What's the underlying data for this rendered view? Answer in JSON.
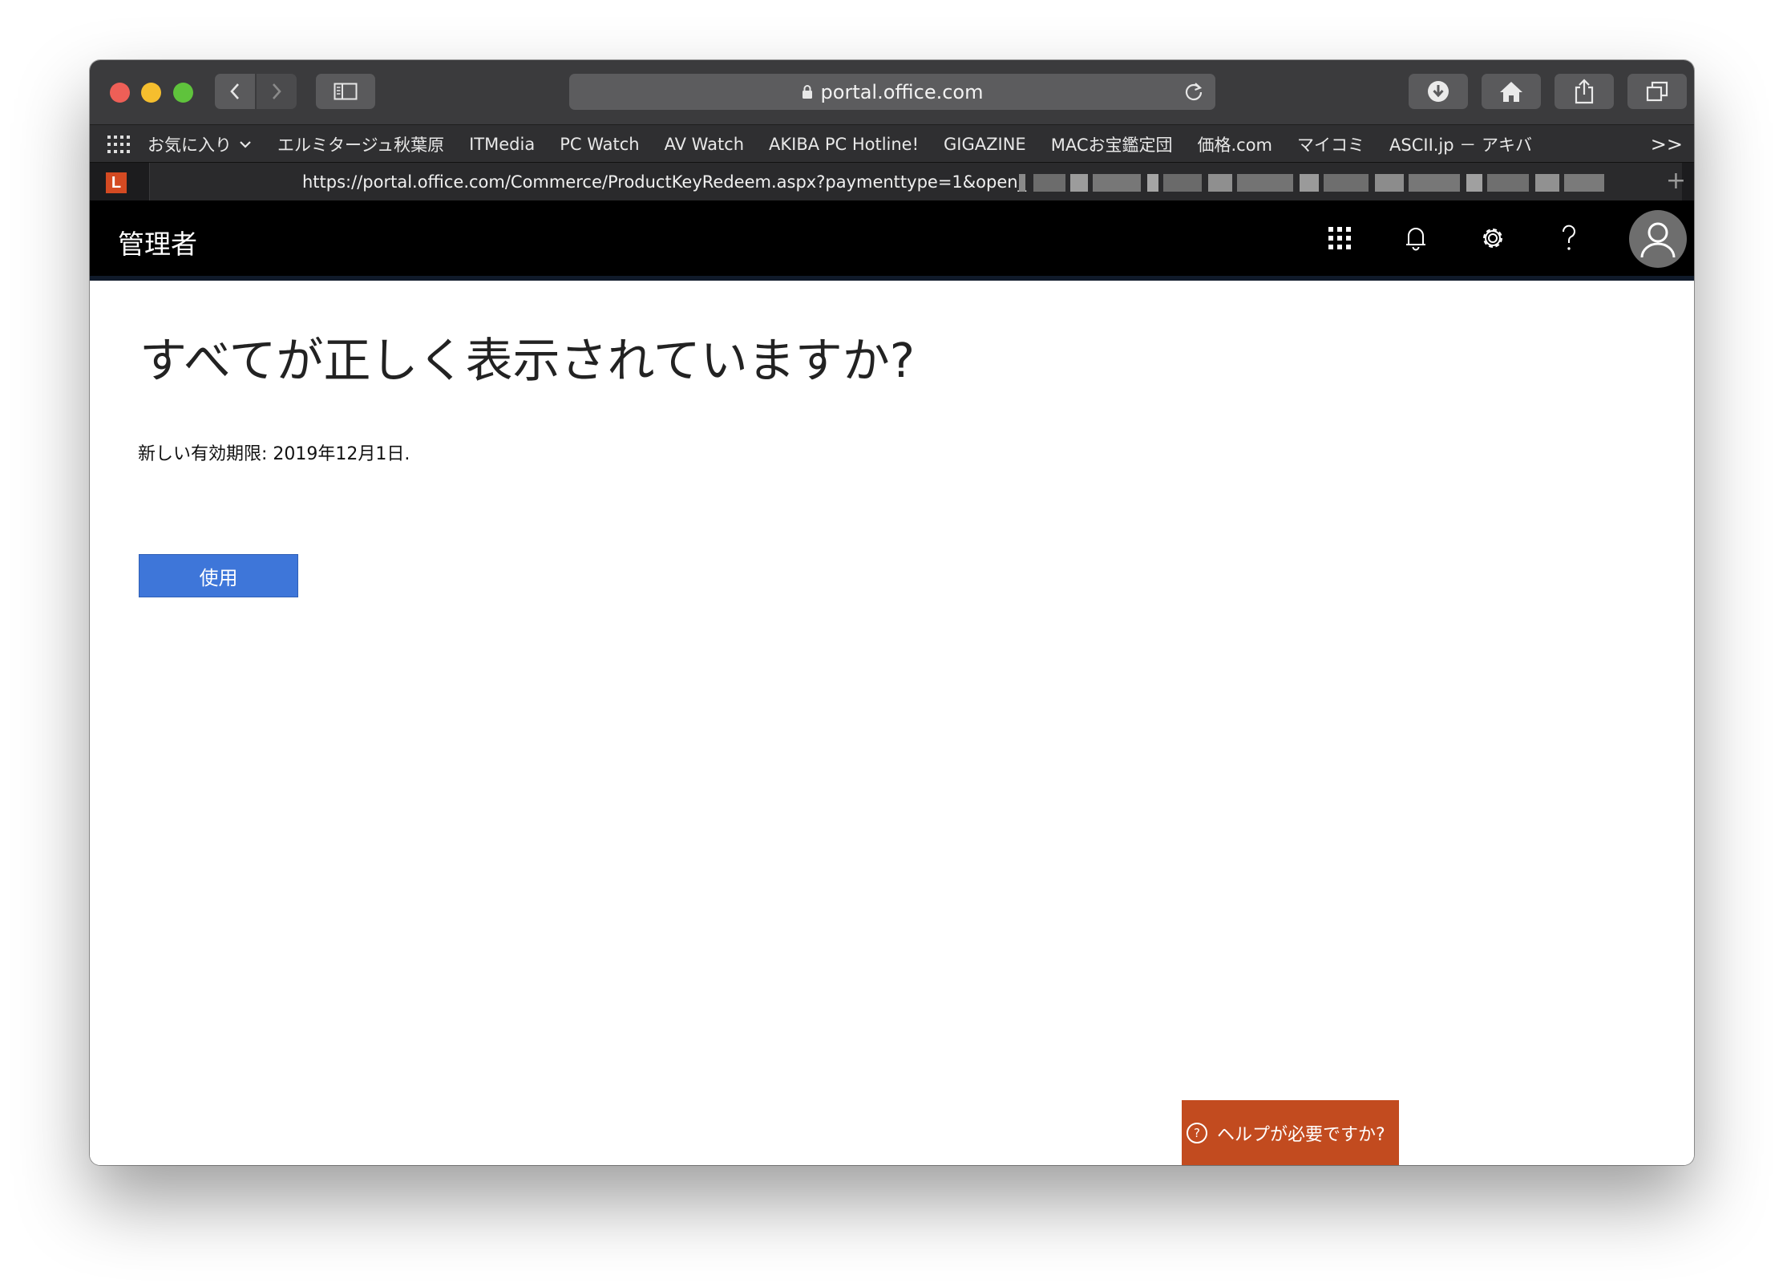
{
  "browser": {
    "address_host": "portal.office.com",
    "full_url": "https://portal.office.com/Commerce/ProductKeyRedeem.aspx?paymenttype=1&open_",
    "bookmarks": [
      {
        "label": "お気に入り",
        "has_chevron": true
      },
      {
        "label": "エルミタージュ秋葉原"
      },
      {
        "label": "ITMedia"
      },
      {
        "label": "PC Watch"
      },
      {
        "label": "AV Watch"
      },
      {
        "label": "AKIBA PC Hotline!"
      },
      {
        "label": "GIGAZINE"
      },
      {
        "label": "MACお宝鑑定団"
      },
      {
        "label": "価格.com"
      },
      {
        "label": "マイコミ"
      },
      {
        "label": "ASCII.jp － アキバ"
      }
    ],
    "bookmarks_more": ">>",
    "tab_favicon_letter": "L",
    "new_tab_symbol": "+"
  },
  "header": {
    "title": "管理者"
  },
  "main": {
    "heading": "すべてが正しく表示されていますか?",
    "expiry_text": "新しい有効期限: 2019年12月1日.",
    "use_button": "使用",
    "help_button": "ヘルプが必要ですか?",
    "help_icon_glyph": "?"
  },
  "colors": {
    "accent_button": "#3e76d9",
    "help_button": "#c24b1f",
    "header_bg": "#000000"
  }
}
